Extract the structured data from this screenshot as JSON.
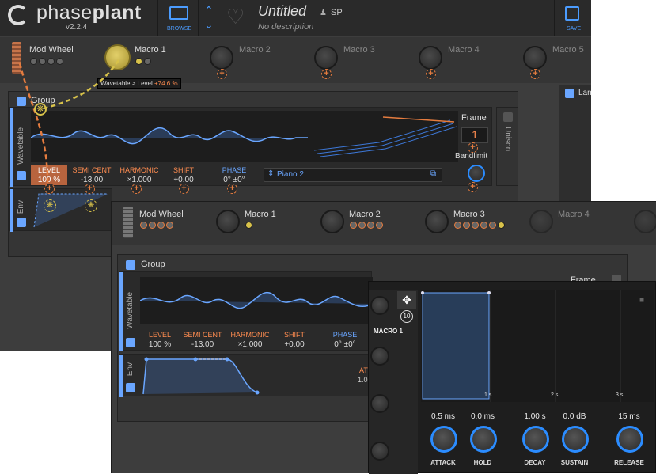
{
  "app": {
    "logo_light": "phase",
    "logo_bold": "plant",
    "version": "v2.2.4",
    "browse_label": "BROWSE",
    "save_label": "SAVE",
    "preset_title": "Untitled",
    "preset_desc": "No description",
    "author": "SP"
  },
  "macros_top": [
    {
      "label": "Mod Wheel"
    },
    {
      "label": "Macro 1"
    },
    {
      "label": "Macro 2"
    },
    {
      "label": "Macro 3"
    },
    {
      "label": "Macro 4"
    },
    {
      "label": "Macro 5"
    }
  ],
  "tooltip": {
    "text": "Wavetable > Level",
    "value": "+74.6 %"
  },
  "group1": {
    "title": "Group",
    "side_label": "Lan",
    "wavetable_label": "Wavetable",
    "env_label": "Env",
    "frame_label": "Frame",
    "frame_value": "1",
    "bandlimit_label": "Bandlimit",
    "unison_label": "Unison",
    "preset_name": "Piano 2",
    "params": [
      {
        "label": "LEVEL",
        "value": "100 %"
      },
      {
        "label": "SEMI CENT",
        "value": "-13.00"
      },
      {
        "label": "HARMONIC",
        "value": "×1.000"
      },
      {
        "label": "SHIFT",
        "value": "+0.00"
      },
      {
        "label": "PHASE",
        "value": "0° ±0°"
      }
    ]
  },
  "macros_bottom": [
    {
      "label": "Mod Wheel"
    },
    {
      "label": "Macro 1"
    },
    {
      "label": "Macro 2"
    },
    {
      "label": "Macro 3"
    },
    {
      "label": "Macro 4"
    }
  ],
  "group2": {
    "title": "Group",
    "wavetable_label": "Wavetable",
    "env_label": "Env",
    "frame_label": "Frame",
    "attack_short": "AT",
    "attack_short_val": "1.0",
    "params": [
      {
        "label": "LEVEL",
        "value": "100 %"
      },
      {
        "label": "SEMI CENT",
        "value": "-13.00"
      },
      {
        "label": "HARMONIC",
        "value": "×1.000"
      },
      {
        "label": "SHIFT",
        "value": "+0.00"
      },
      {
        "label": "PHASE",
        "value": "0° ±0°"
      }
    ]
  },
  "env_editor": {
    "macro_label": "MACRO 1",
    "mod_count": "10",
    "time_marks": [
      "1 s",
      "2 s",
      "3 s"
    ],
    "knobs": [
      {
        "label": "ATTACK",
        "value": "0.5 ms"
      },
      {
        "label": "HOLD",
        "value": "0.0 ms"
      },
      {
        "label": "DECAY",
        "value": "1.00 s"
      },
      {
        "label": "SUSTAIN",
        "value": "0.0 dB"
      },
      {
        "label": "RELEASE",
        "value": "15 ms"
      }
    ]
  },
  "colors": {
    "accent_blue": "#6aa6ff",
    "mod_orange": "#e57c3f",
    "macro_yellow": "#d8c24a",
    "bg": "#3d3d3d"
  }
}
